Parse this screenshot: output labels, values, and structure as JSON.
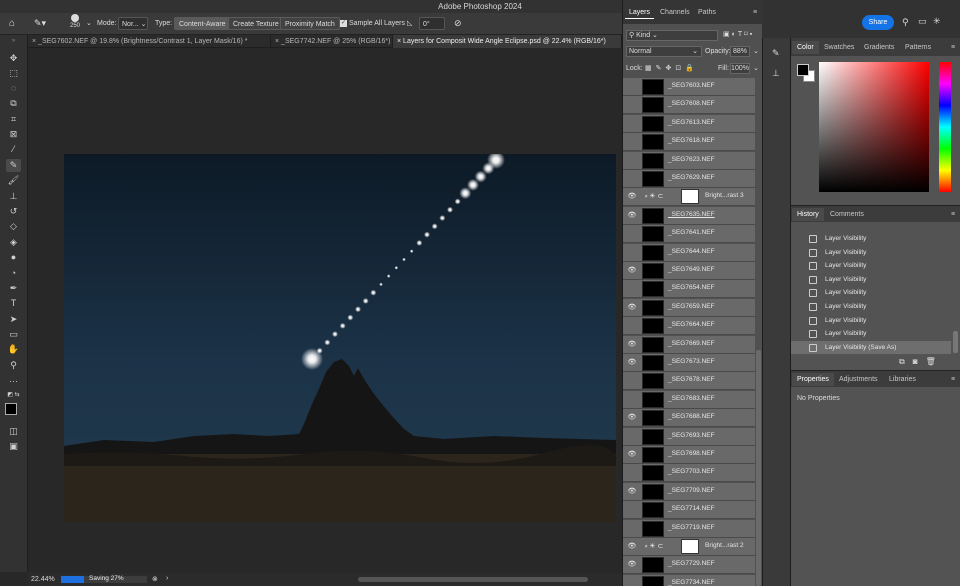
{
  "app": {
    "title": "Adobe Photoshop 2024"
  },
  "options": {
    "brush_size": "250",
    "mode_label": "Mode:",
    "mode_value": "Nor...",
    "type_label": "Type:",
    "content_aware": "Content-Aware",
    "create_texture": "Create Texture",
    "proximity_match": "Proximity Match",
    "sample_all_layers": "Sample All Layers",
    "angle": "0°"
  },
  "doc_tabs": [
    {
      "label": "_SEG7602.NEF @ 19.8% (Brightness/Contrast 1, Layer Mask/16) *"
    },
    {
      "label": "_SEG7742.NEF @ 25% (RGB/16*)"
    },
    {
      "label": "Layers for Composit Wide Angle Eclipse.psd @ 22.4% (RGB/16*)"
    }
  ],
  "status": {
    "zoom": "22.44%",
    "saving": "Saving 27%",
    "progress": 0.27
  },
  "layers_panel": {
    "tabs": [
      "Layers",
      "Channels",
      "Paths"
    ],
    "filter": "Kind",
    "blend_mode": "Normal",
    "opacity_label": "Opacity:",
    "opacity_value": "88%",
    "lock_label": "Lock:",
    "fill_label": "Fill:",
    "fill_value": "100%",
    "layers": [
      {
        "name": "_SEG7603.NEF",
        "visible": false,
        "type": "image"
      },
      {
        "name": "_SEG7608.NEF",
        "visible": false,
        "type": "image"
      },
      {
        "name": "_SEG7613.NEF",
        "visible": false,
        "type": "image"
      },
      {
        "name": "_SEG7618.NEF",
        "visible": false,
        "type": "image"
      },
      {
        "name": "_SEG7623.NEF",
        "visible": false,
        "type": "image"
      },
      {
        "name": "_SEG7629.NEF",
        "visible": false,
        "type": "image"
      },
      {
        "name": "Bright...rast 3",
        "visible": true,
        "type": "adjustment"
      },
      {
        "name": "_SEG7635.NEF",
        "visible": true,
        "type": "image"
      },
      {
        "name": "_SEG7641.NEF",
        "visible": false,
        "type": "image"
      },
      {
        "name": "_SEG7644.NEF",
        "visible": false,
        "type": "image"
      },
      {
        "name": "_SEG7649.NEF",
        "visible": true,
        "type": "image"
      },
      {
        "name": "_SEG7654.NEF",
        "visible": false,
        "type": "image"
      },
      {
        "name": "_SEG7659.NEF",
        "visible": true,
        "type": "image"
      },
      {
        "name": "_SEG7664.NEF",
        "visible": false,
        "type": "image"
      },
      {
        "name": "_SEG7669.NEF",
        "visible": true,
        "type": "image"
      },
      {
        "name": "_SEG7673.NEF",
        "visible": true,
        "type": "image"
      },
      {
        "name": "_SEG7678.NEF",
        "visible": false,
        "type": "image"
      },
      {
        "name": "_SEG7683.NEF",
        "visible": false,
        "type": "image"
      },
      {
        "name": "_SEG7688.NEF",
        "visible": true,
        "type": "image"
      },
      {
        "name": "_SEG7693.NEF",
        "visible": false,
        "type": "image"
      },
      {
        "name": "_SEG7698.NEF",
        "visible": true,
        "type": "image"
      },
      {
        "name": "_SEG7703.NEF",
        "visible": false,
        "type": "image"
      },
      {
        "name": "_SEG7709.NEF",
        "visible": true,
        "type": "image"
      },
      {
        "name": "_SEG7714.NEF",
        "visible": false,
        "type": "image"
      },
      {
        "name": "_SEG7719.NEF",
        "visible": false,
        "type": "image"
      },
      {
        "name": "Bright...rast 2",
        "visible": true,
        "type": "adjustment"
      },
      {
        "name": "_SEG7729.NEF",
        "visible": true,
        "type": "image"
      },
      {
        "name": "_SEG7734.NEF",
        "visible": false,
        "type": "image"
      }
    ]
  },
  "top_right": {
    "share": "Share"
  },
  "color_panel": {
    "tabs": [
      "Color",
      "Swatches",
      "Gradients",
      "Patterns"
    ]
  },
  "history_panel": {
    "tabs": [
      "History",
      "Comments"
    ],
    "items": [
      "Layer Visibility",
      "Layer Visibility",
      "Layer Visibility",
      "Layer Visibility",
      "Layer Visibility",
      "Layer Visibility",
      "Layer Visibility",
      "Layer Visibility",
      "Layer Visibility (Save As)"
    ]
  },
  "properties_panel": {
    "tabs": [
      "Properties",
      "Adjustments",
      "Libraries"
    ],
    "empty_text": "No Properties"
  },
  "colors": {
    "ui_dark": "#282828",
    "layer_row": "#696969",
    "accent_blue": "#1e6fe0",
    "share_blue": "#1473e6"
  }
}
